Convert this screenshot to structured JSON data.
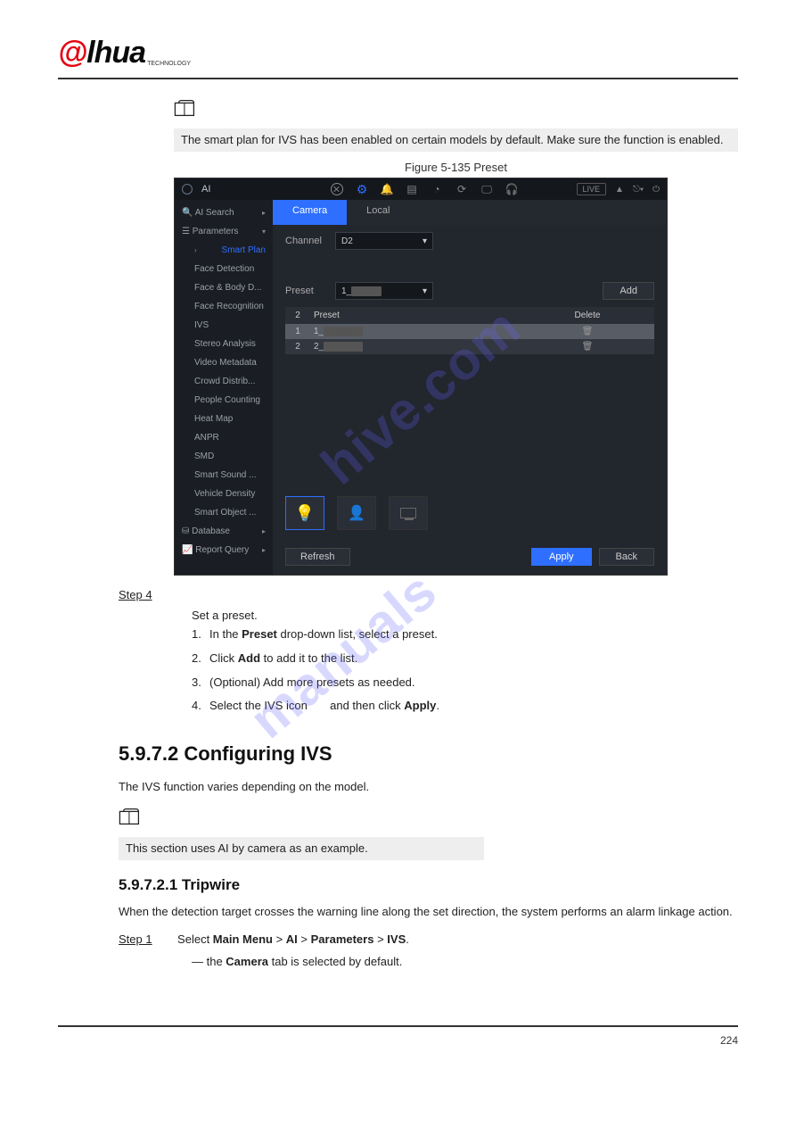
{
  "logo": {
    "a": "@",
    "lhua": "lhua",
    "sub": "TECHNOLOGY"
  },
  "note1": "The smart plan for IVS has been enabled on certain models by default. Make sure the function is enabled.",
  "figure_caption": "Figure 5-135 Preset",
  "screenshot": {
    "title": "AI",
    "live": "LIVE",
    "top_right": "▲  ⎋▾ ⏻",
    "sidebar": {
      "ai_search": "AI Search",
      "parameters": "Parameters",
      "items": [
        "Smart Plan",
        "Face Detection",
        "Face & Body D...",
        "Face Recognition",
        "IVS",
        "Stereo Analysis",
        "Video Metadata",
        "Crowd Distrib...",
        "People Counting",
        "Heat Map",
        "ANPR",
        "SMD",
        "Smart Sound ...",
        "Vehicle Density",
        "Smart Object ..."
      ],
      "database": "Database",
      "report_query": "Report Query"
    },
    "tabs": {
      "camera": "Camera",
      "local": "Local"
    },
    "channel_label": "Channel",
    "channel_value": "D2",
    "preset_label": "Preset",
    "preset_value": "1_",
    "add_btn": "Add",
    "table": {
      "h1": "2",
      "h2": "Preset",
      "h3": "Delete",
      "r1n": "1",
      "r1p": "1_",
      "r2n": "2",
      "r2p": "2_"
    },
    "refresh": "Refresh",
    "apply": "Apply",
    "back": "Back"
  },
  "step4_label": "Step 4",
  "step4_text": "Set a preset.",
  "step4_list": [
    {
      "n": "1.",
      "t": "In the **Preset** drop-down list, select a preset."
    },
    {
      "n": "2.",
      "t": "Click **Add** to add it to the list."
    },
    {
      "n": "3.",
      "t": "(Optional) Add more presets as needed."
    },
    {
      "n": "4.",
      "t": "Select the IVS icon      and then click **Apply**."
    }
  ],
  "section_h2": "5.9.7.2 Configuring IVS",
  "note2": "This section uses AI by camera as an example.",
  "note2_pre": "The IVS function varies depending on the model.",
  "section_h3": "5.9.7.2.1 Tripwire",
  "trip_p1": "When the detection target crosses the warning line along the set direction, the system performs an alarm linkage action.",
  "step1_label": "Step 1",
  "step1_text": "Select **Main Menu** > **AI** > **Parameters** > **IVS**.",
  "step1_tail": "— the **Camera** tab is selected by default.",
  "footer": "224"
}
